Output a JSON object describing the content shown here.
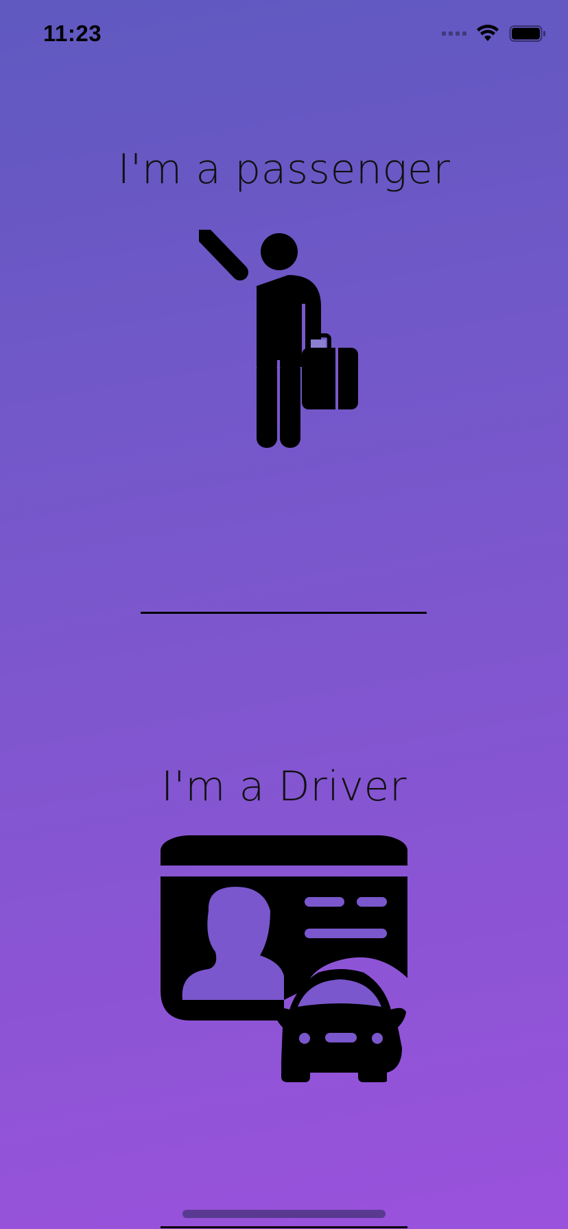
{
  "status_bar": {
    "time": "11:23",
    "icons": [
      "signal-icon",
      "wifi-icon",
      "battery-icon"
    ]
  },
  "options": {
    "passenger": {
      "label": "I'm a passenger",
      "icon": "hitchhiker-with-briefcase-icon"
    },
    "driver": {
      "label": "I'm a Driver",
      "icon": "driver-license-car-icon"
    }
  },
  "colors": {
    "gradient_top": "#5f59c0",
    "gradient_bottom": "#9a52dc",
    "foreground": "#000000"
  }
}
